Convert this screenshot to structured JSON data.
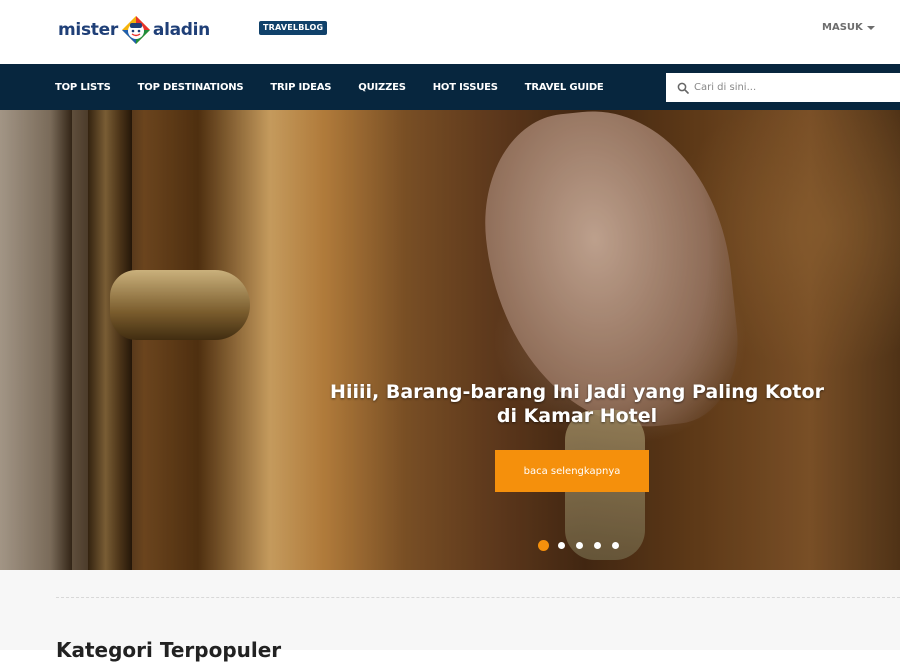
{
  "header": {
    "logo": {
      "word_left": "mister",
      "word_right": "aladin"
    },
    "badge": "TRAVELBLOG",
    "login_label": "MASUK"
  },
  "nav": {
    "items": [
      {
        "label": "TOP LISTS"
      },
      {
        "label": "TOP DESTINATIONS"
      },
      {
        "label": "TRIP IDEAS"
      },
      {
        "label": "QUIZZES"
      },
      {
        "label": "HOT ISSUES"
      },
      {
        "label": "TRAVEL GUIDE"
      }
    ],
    "search": {
      "placeholder": "Cari di sini...",
      "value": "",
      "icon": "search-icon"
    }
  },
  "hero": {
    "title": "Hiiii, Barang-barang Ini Jadi yang Paling Kotor di Kamar Hotel",
    "cta_label": "baca selengkapnya",
    "slides_total": 5,
    "active_slide": 1
  },
  "section": {
    "title": "Kategori Terpopuler"
  },
  "colors": {
    "nav_bg": "#07263e",
    "accent": "#f5900c",
    "logo_blue": "#1f3f77",
    "badge_bg": "#10416a"
  }
}
